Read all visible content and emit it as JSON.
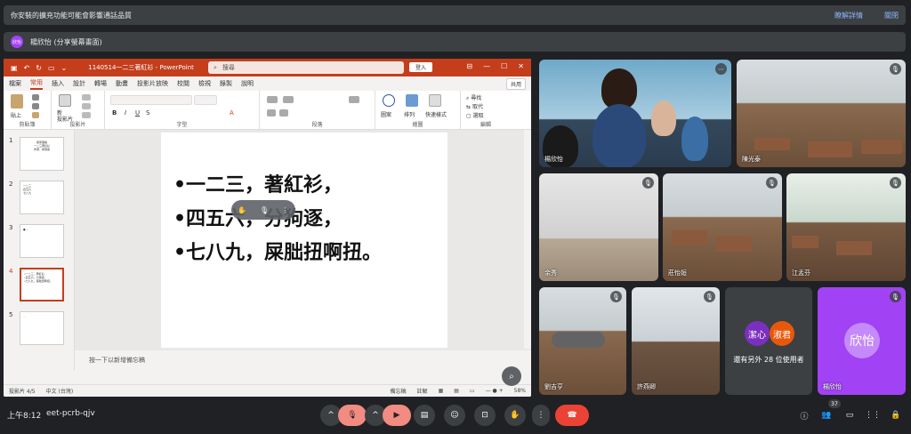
{
  "banner": {
    "message": "你安裝的擴充功能可能會影響通話品質",
    "details": "瞭解詳情",
    "close": "關閉"
  },
  "presenter": {
    "avatar_text": "欣怡",
    "label": "楊欣怡 (分享螢幕畫面)"
  },
  "ppt": {
    "filename": "1140514一二三著紅衫 - PowerPoint",
    "search_placeholder": "搜尋",
    "signin": "登入",
    "tabs": [
      "檔案",
      "常用",
      "插入",
      "設計",
      "轉場",
      "動畫",
      "投影片放映",
      "校閱",
      "檢視",
      "錄製",
      "說明"
    ],
    "active_tab": "常用",
    "share": "共用",
    "ribbon": {
      "paste": "貼上",
      "new_slide": "新\n投影片",
      "groups": [
        "剪貼簿",
        "投影片",
        "字型",
        "段落",
        "繪圖",
        "編輯"
      ],
      "shapes": "圖案",
      "arrange": "排列",
      "quick_styles": "快速樣式",
      "find": "尋找",
      "replace": "取代",
      "select": "選取"
    },
    "thumbnails": [
      {
        "num": "1",
        "text": "客家童謠\n一二三著紅衫\n作者：黃瑞循"
      },
      {
        "num": "2",
        "text": "一二三\n四五六\n七八九"
      },
      {
        "num": "3",
        "text": "● ..."
      },
      {
        "num": "4",
        "text": "•一二三，著紅衫，\n•四五六，分狗逐，\n•七八九，屎朏扭啊扭。"
      },
      {
        "num": "5",
        "text": "..."
      }
    ],
    "selected_thumbnail": "4",
    "slide_lines": [
      "•一二三，著紅衫，",
      "•四五六，分狗逐，",
      "•七八九，屎朏扭啊扭。"
    ],
    "notes_placeholder": "按一下以新增備忘稿",
    "status": {
      "slide": "投影片 4/5",
      "lang": "中文 (台灣)",
      "notes": "備忘稿",
      "comments": "註解",
      "zoom": "58%"
    }
  },
  "participants": [
    {
      "name": "楊欣怡",
      "muted": false
    },
    {
      "name": "陳光泰",
      "muted": true
    },
    {
      "name": "余秀",
      "muted": true
    },
    {
      "name": "莊怡姮",
      "muted": true
    },
    {
      "name": "江孟芬",
      "muted": true
    },
    {
      "name": "劉吉亨",
      "muted": true
    },
    {
      "name": "許燕卿",
      "muted": true
    },
    {
      "name": "還有另外 28 位使用者",
      "avatars": [
        "潔心",
        "淑君"
      ]
    },
    {
      "name": "楊欣怡",
      "avatar": "欣怡",
      "muted": true
    }
  ],
  "bottombar": {
    "time": "上午8:12",
    "meeting_code": "eet-pcrb-qjv",
    "people_count": "37"
  },
  "colors": {
    "ppt_accent": "#c43e1c",
    "end_call": "#ea4335",
    "muted_btn": "#f28b82"
  }
}
